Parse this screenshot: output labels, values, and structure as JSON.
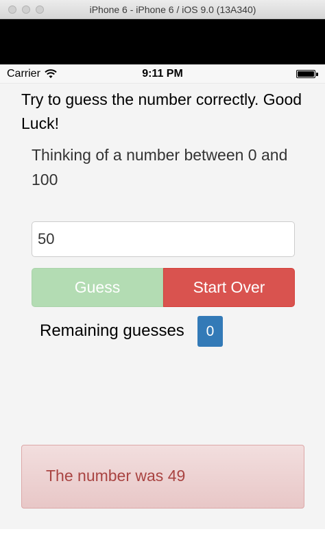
{
  "window": {
    "title": "iPhone 6 - iPhone 6 / iOS 9.0 (13A340)"
  },
  "status_bar": {
    "carrier": "Carrier",
    "time": "9:11 PM",
    "wifi_icon": "wifi-icon",
    "battery_icon": "battery-full-icon"
  },
  "app": {
    "headline": "Try to guess the number correctly. Good Luck!",
    "prompt": "Thinking of a number between 0 and 100",
    "guess_input": {
      "value": "50",
      "placeholder": ""
    },
    "guess_button": "Guess",
    "start_over_button": "Start Over",
    "remaining_label": "Remaining guesses",
    "remaining_count": "0",
    "result_message": "The number was 49"
  },
  "colors": {
    "guess_button_disabled": "#b3dcb3",
    "start_over_button": "#d9534f",
    "badge": "#337ab7",
    "alert_background": "#f2dede",
    "alert_text": "#a94442"
  }
}
